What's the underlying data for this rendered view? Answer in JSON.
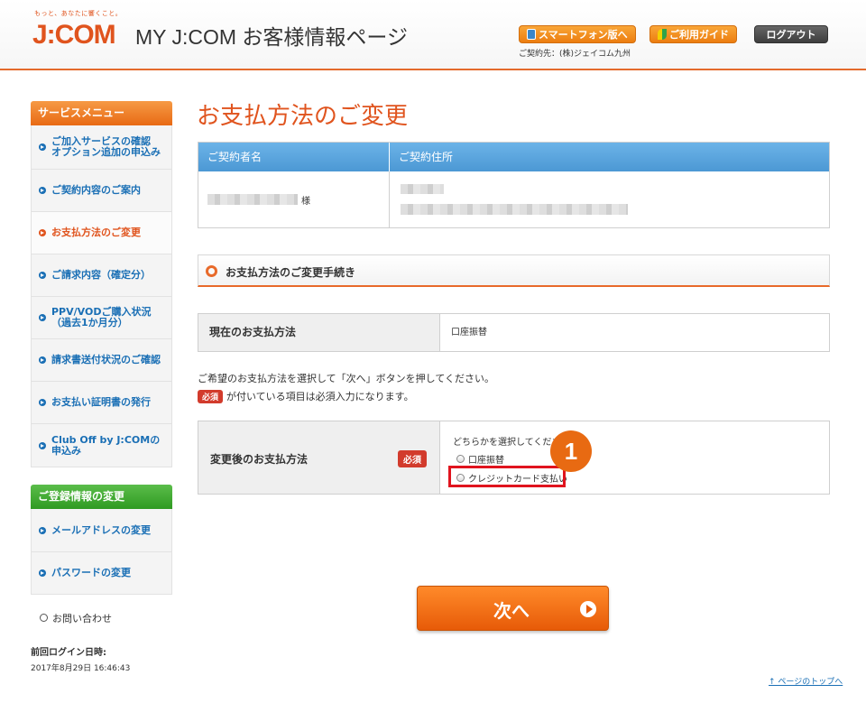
{
  "header": {
    "logo_tagline": "もっと、あなたに響くこと。",
    "logo_text": "J:COM",
    "site_title": "MY J:COM お客様情報ページ",
    "smartphone_button": "スマートフォン版へ",
    "guide_button": "ご利用ガイド",
    "logout_button": "ログアウト",
    "contract_note": "ご契約先：(株)ジェイコム九州"
  },
  "sidebar": {
    "service_menu_title": "サービスメニュー",
    "service_items": [
      {
        "line1": "ご加入サービスの確認",
        "line2": "オプション追加の申込み"
      },
      {
        "line1": "ご契約内容のご案内",
        "line2": ""
      },
      {
        "line1": "お支払方法のご変更",
        "line2": ""
      },
      {
        "line1": "ご請求内容（確定分）",
        "line2": ""
      },
      {
        "line1": "PPV/VODご購入状況",
        "line2": "（過去1か月分）"
      },
      {
        "line1": "請求書送付状況のご確認",
        "line2": ""
      },
      {
        "line1": "お支払い証明書の発行",
        "line2": ""
      },
      {
        "line1": "Club Off by J:COMの",
        "line2": "申込み"
      }
    ],
    "registration_title": "ご登録情報の変更",
    "registration_items": [
      {
        "line1": "メールアドレスの変更"
      },
      {
        "line1": "パスワードの変更"
      }
    ],
    "inquiry": "お問い合わせ",
    "last_login_label": "前回ログイン日時:",
    "last_login_value": "2017年8月29日 16:46:43"
  },
  "main": {
    "page_title": "お支払方法のご変更",
    "contract_table": {
      "col1_header": "ご契約者名",
      "col2_header": "ご契約住所",
      "name_suffix": "様"
    },
    "section_title": "お支払方法のご変更手続き",
    "current_method_label": "現在のお支払方法",
    "current_method_value": "口座振替",
    "instruction_1": "ご希望のお支払方法を選択して「次へ」ボタンを押してください。",
    "required_badge": "必須",
    "instruction_2": "が付いている項目は必須入力になります。",
    "new_method_label": "変更後のお支払方法",
    "choose_prompt": "どちらかを選択してください",
    "option_1": "口座振替",
    "option_2": "クレジットカード支払い",
    "step_number": "1",
    "next_button": "次へ",
    "page_top_link": "↑ ページのトップへ"
  }
}
